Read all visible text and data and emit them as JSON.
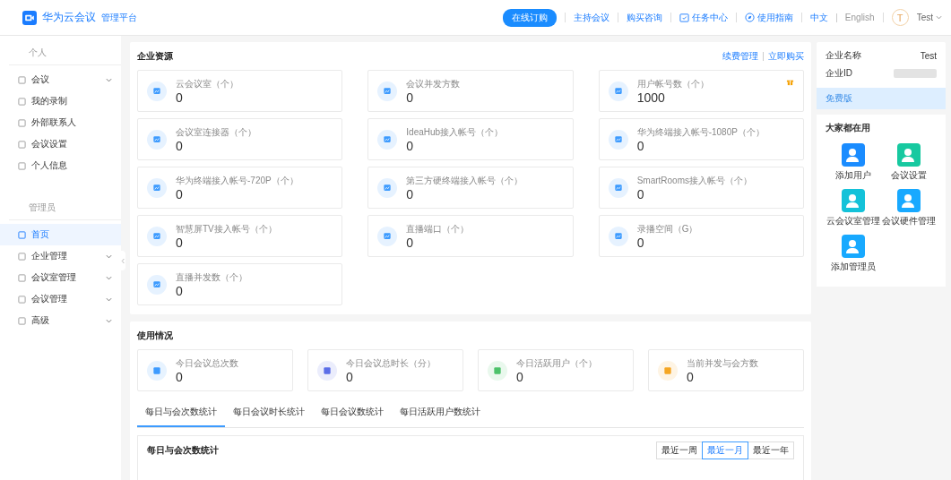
{
  "header": {
    "logo_title": "华为云会议",
    "logo_subtitle": "管理平台",
    "order_button": "在线订购",
    "links": [
      {
        "label": "主持会议",
        "kind": "plain"
      },
      {
        "label": "购买咨询",
        "kind": "plain"
      },
      {
        "label": "任务中心",
        "kind": "task"
      },
      {
        "label": "使用指南",
        "kind": "guide"
      }
    ],
    "languages": [
      {
        "label": "中文",
        "selected": true
      },
      {
        "label": "English",
        "selected": false
      }
    ],
    "avatar_letter": "T",
    "user": "Test"
  },
  "sidebar": {
    "sections": [
      {
        "title": "个人",
        "items": [
          {
            "label": "会议",
            "kind": "group",
            "expanded": false,
            "selected": false
          },
          {
            "label": "我的录制",
            "kind": "link",
            "selected": false
          },
          {
            "label": "外部联系人",
            "kind": "link",
            "selected": false
          },
          {
            "label": "会议设置",
            "kind": "link",
            "selected": false
          },
          {
            "label": "个人信息",
            "kind": "link",
            "selected": false
          }
        ]
      },
      {
        "title": "管理员",
        "items": [
          {
            "label": "首页",
            "kind": "link",
            "selected": true
          },
          {
            "label": "企业管理",
            "kind": "group",
            "expanded": false,
            "selected": false
          },
          {
            "label": "会议室管理",
            "kind": "group",
            "expanded": false,
            "selected": false
          },
          {
            "label": "会议管理",
            "kind": "group",
            "expanded": false,
            "selected": false
          },
          {
            "label": "高级",
            "kind": "group",
            "expanded": false,
            "selected": false
          }
        ]
      }
    ]
  },
  "resources": {
    "title": "企业资源",
    "links": [
      "续费管理",
      "立即购买"
    ],
    "cards": [
      {
        "label": "云会议室（个）",
        "value": "0"
      },
      {
        "label": "会议并发方数",
        "value": "0"
      },
      {
        "label": "用户帐号数（个）",
        "value": "1000",
        "gift": true
      },
      {
        "label": "会议室连接器（个）",
        "value": "0"
      },
      {
        "label": "IdeaHub接入帐号（个）",
        "value": "0"
      },
      {
        "label": "华为终端接入帐号-1080P（个）",
        "value": "0"
      },
      {
        "label": "华为终端接入帐号-720P（个）",
        "value": "0"
      },
      {
        "label": "第三方硬终端接入帐号（个）",
        "value": "0"
      },
      {
        "label": "SmartRooms接入帐号（个）",
        "value": "0"
      },
      {
        "label": "智慧屏TV接入帐号（个）",
        "value": "0"
      },
      {
        "label": "直播端口（个）",
        "value": "0"
      },
      {
        "label": "录播空间（G）",
        "value": "0"
      },
      {
        "label": "直播并发数（个）",
        "value": "0"
      }
    ]
  },
  "usage": {
    "title": "使用情况",
    "cards": [
      {
        "label": "今日会议总次数",
        "value": "0",
        "color": "#3d9bff"
      },
      {
        "label": "今日会议总时长（分）",
        "value": "0",
        "color": "#5b6ee8"
      },
      {
        "label": "今日活跃用户（个）",
        "value": "0",
        "color": "#4cc26a"
      },
      {
        "label": "当前并发与会方数",
        "value": "0",
        "color": "#f5a623"
      }
    ],
    "tabs": [
      {
        "label": "每日与会次数统计",
        "selected": true
      },
      {
        "label": "每日会议时长统计",
        "selected": false
      },
      {
        "label": "每日会议数统计",
        "selected": false
      },
      {
        "label": "每日活跃用户数统计",
        "selected": false
      }
    ],
    "chart_title": "每日与会次数统计",
    "ranges": [
      {
        "label": "最近一周",
        "selected": false
      },
      {
        "label": "最近一月",
        "selected": true
      },
      {
        "label": "最近一年",
        "selected": false
      }
    ]
  },
  "enterprise": {
    "name_label": "企业名称",
    "name_value": "Test",
    "id_label": "企业ID",
    "edition": "免费版"
  },
  "tools": {
    "title": "大家都在用",
    "items": [
      {
        "label": "添加用户",
        "color": "#1a8cff"
      },
      {
        "label": "会议设置",
        "color": "#17c9a0"
      },
      {
        "label": "云会议室管理",
        "color": "#14c2d9"
      },
      {
        "label": "会议硬件管理",
        "color": "#18a9ff"
      },
      {
        "label": "添加管理员",
        "color": "#18a9ff"
      }
    ]
  }
}
